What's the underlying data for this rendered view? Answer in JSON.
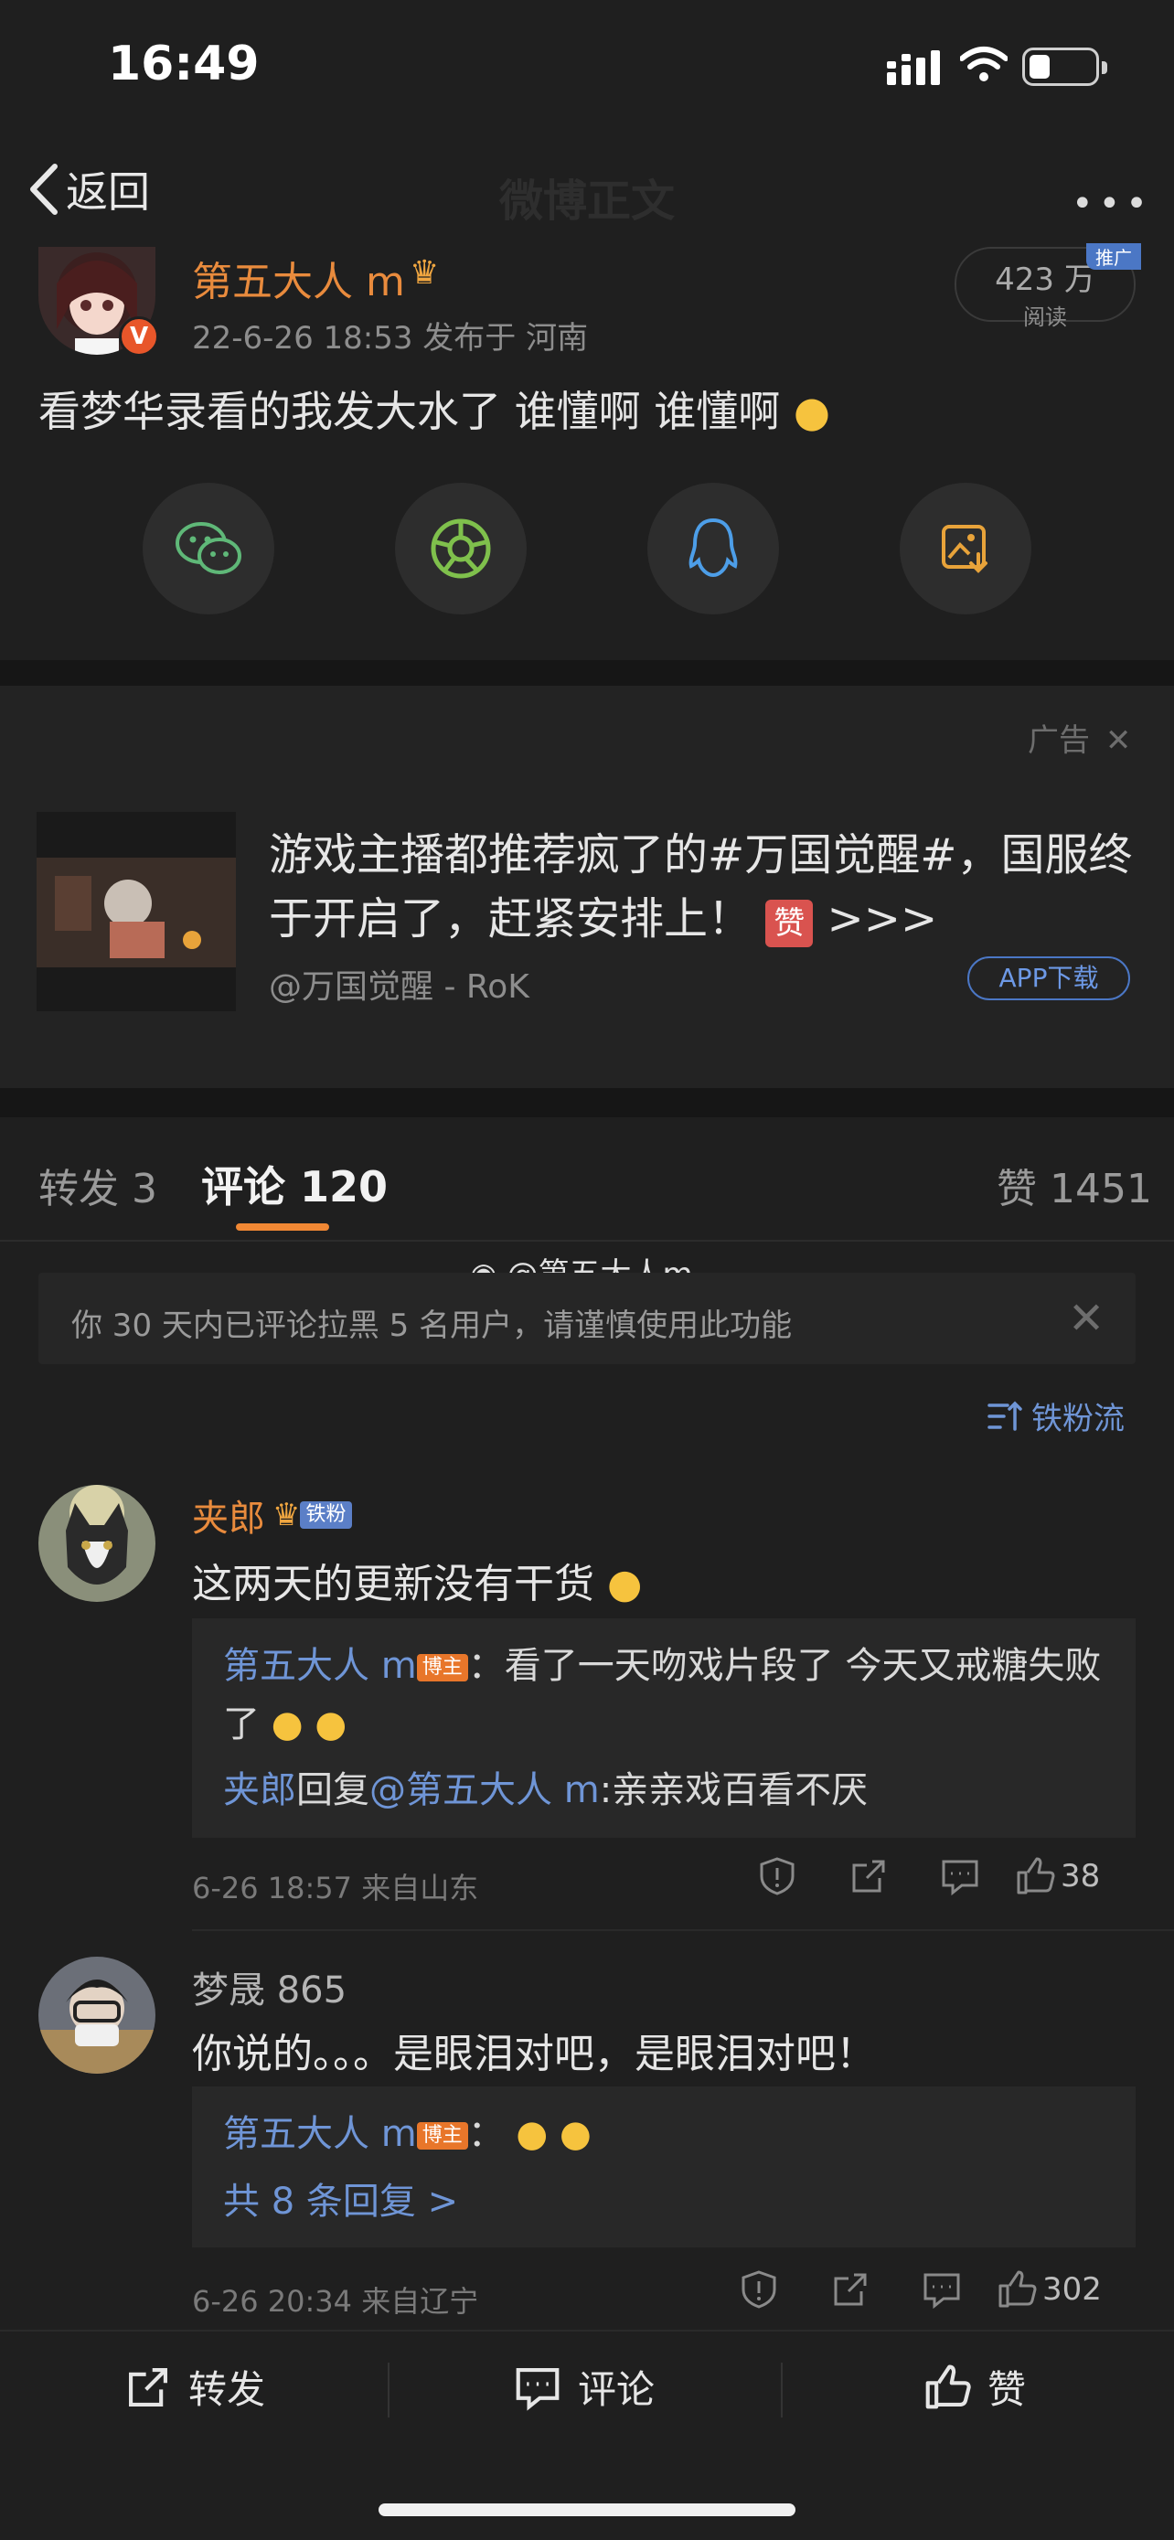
{
  "status_bar": {
    "time": "16:49"
  },
  "nav": {
    "back_label": "返回",
    "title": "微博正文"
  },
  "post": {
    "author": "第五大人 m",
    "meta": "22-6-26 18:53  发布于 河南",
    "reads": "423 万",
    "reads_label": "阅读",
    "promo_tag": "推广",
    "text": "看梦华录看的我发大水了 谁懂啊 谁懂啊",
    "share_icons": [
      "wechat-icon",
      "moments-icon",
      "qq-icon",
      "save-image-icon"
    ]
  },
  "ad": {
    "label": "广告",
    "text": "游戏主播都推荐疯了的#万国觉醒#，国服终于开启了，赶紧安排上！",
    "arrows": ">>>",
    "source": "@万国觉醒 - RoK",
    "button": "APP下载"
  },
  "tabs": {
    "repost": "转发 3",
    "comment": "评论 120",
    "like": "赞 1451"
  },
  "watermark": "@第五大人m",
  "notice": "你 30 天内已评论拉黑 5 名用户，请谨慎使用此功能",
  "sort_label": "铁粉流",
  "comments": [
    {
      "name": "夹郎",
      "badge": "铁粉",
      "text": "这两天的更新没有干货",
      "replies": [
        {
          "author": "第五大人 m",
          "host_badge": "博主",
          "text": "：看了一天吻戏片段了 今天又戒糖失败了"
        },
        {
          "author": "夹郎",
          "reply_word": "回复",
          "target": "@第五大人 m",
          "text": ":亲亲戏百看不厌"
        }
      ],
      "meta": "6-26 18:57  来自山东",
      "likes": "38"
    },
    {
      "name": "梦晟 865",
      "text": "你说的。。。是眼泪对吧，是眼泪对吧！",
      "replies": [
        {
          "author": "第五大人 m",
          "host_badge": "博主",
          "text": "："
        }
      ],
      "more_replies": "共 8 条回复 >",
      "meta": "6-26 20:34  来自辽宁",
      "likes": "302"
    }
  ],
  "bottom_bar": {
    "repost": "转发",
    "comment": "评论",
    "like": "赞"
  },
  "colors": {
    "accent": "#f18834",
    "link": "#6f95d6",
    "author": "#e98b3d"
  }
}
